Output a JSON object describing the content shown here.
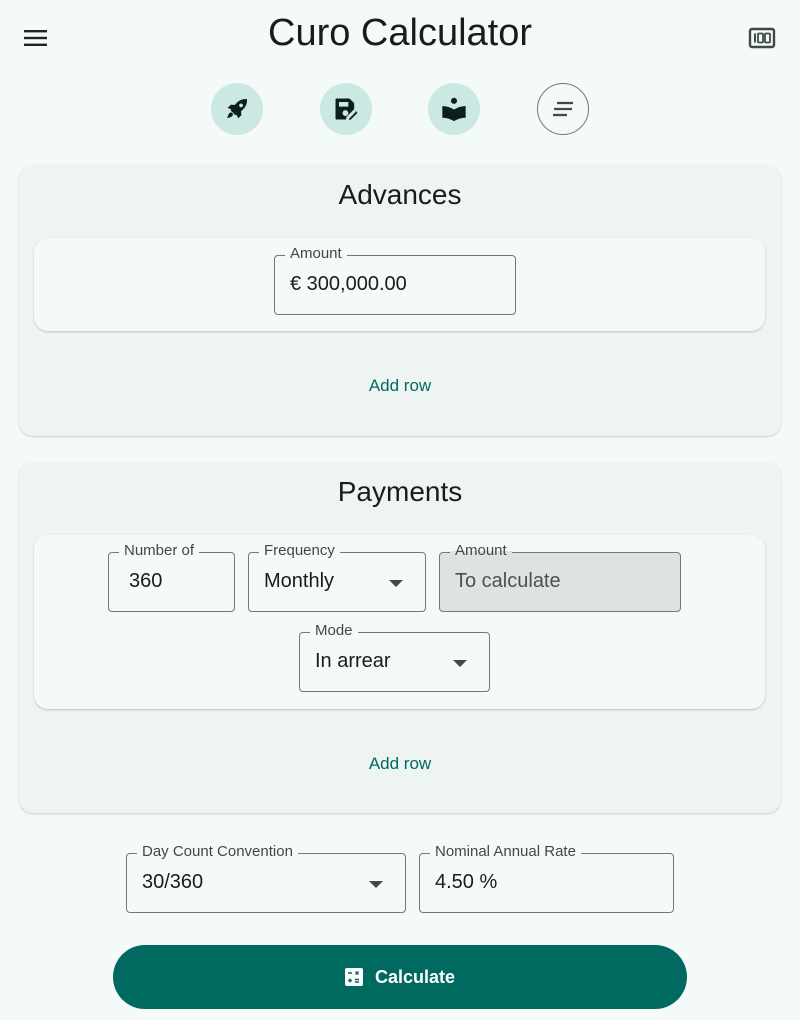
{
  "app": {
    "title": "Curo Calculator",
    "menu_icon": "menu-icon",
    "right_icon": "counter-100-icon"
  },
  "toolbar": {
    "icons": [
      {
        "name": "rocket-icon",
        "style": "filled"
      },
      {
        "name": "save-edit-icon",
        "style": "filled"
      },
      {
        "name": "reading-book-icon",
        "style": "filled"
      },
      {
        "name": "notes-icon",
        "style": "outlined"
      }
    ]
  },
  "advances": {
    "title": "Advances",
    "rows": [
      {
        "amount_label": "Amount",
        "amount_value": "€ 300,000.00"
      }
    ],
    "add_row_label": "Add row"
  },
  "payments": {
    "title": "Payments",
    "rows": [
      {
        "number_label": "Number of",
        "number_value": "360",
        "frequency_label": "Frequency",
        "frequency_value": "Monthly",
        "amount_label": "Amount",
        "amount_placeholder": "To calculate",
        "mode_label": "Mode",
        "mode_value": "In arrear"
      }
    ],
    "add_row_label": "Add row"
  },
  "settings": {
    "day_count_label": "Day Count Convention",
    "day_count_value": "30/360",
    "rate_label": "Nominal Annual Rate",
    "rate_value": "4.50 %"
  },
  "calculate": {
    "label": "Calculate",
    "icon": "calculate-icon"
  },
  "colors": {
    "primary": "#006a60",
    "background": "#f4faf8",
    "tonal": "#cce8e2",
    "card": "#eef4f2"
  }
}
